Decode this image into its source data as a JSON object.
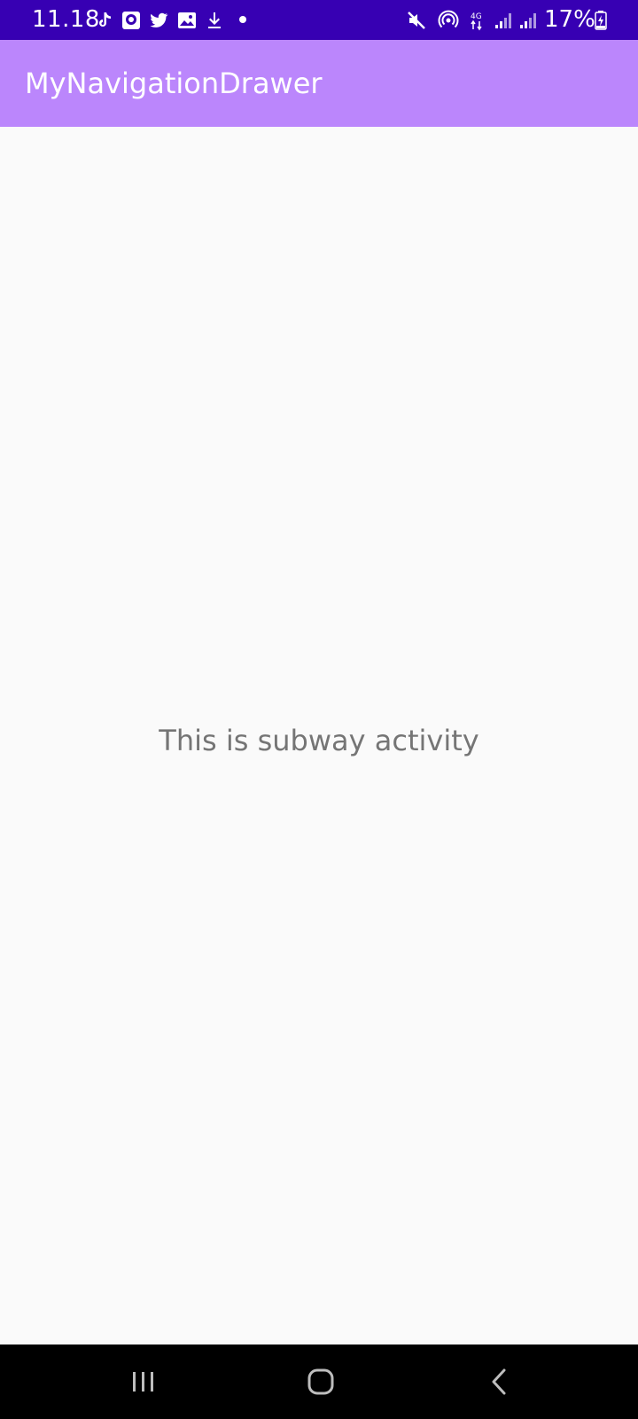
{
  "status_bar": {
    "time": "11.18",
    "battery_percent": "17%",
    "notification_icons": [
      "tiktok-icon",
      "messenger-icon",
      "twitter-icon",
      "gallery-icon",
      "download-icon",
      "dot-icon"
    ],
    "system_icons": [
      "mute-icon",
      "hotspot-icon",
      "4g-data-icon",
      "signal-icon",
      "signal-icon",
      "battery-charging-icon"
    ],
    "network_label": "4G",
    "background_color": "#3700b3"
  },
  "app_bar": {
    "title": "MyNavigationDrawer",
    "background_color": "#bb86fc"
  },
  "main": {
    "message": "This is subway activity",
    "text_color": "#757575"
  },
  "nav_bar": {
    "buttons": [
      "recent-apps-icon",
      "home-icon",
      "back-icon"
    ]
  }
}
